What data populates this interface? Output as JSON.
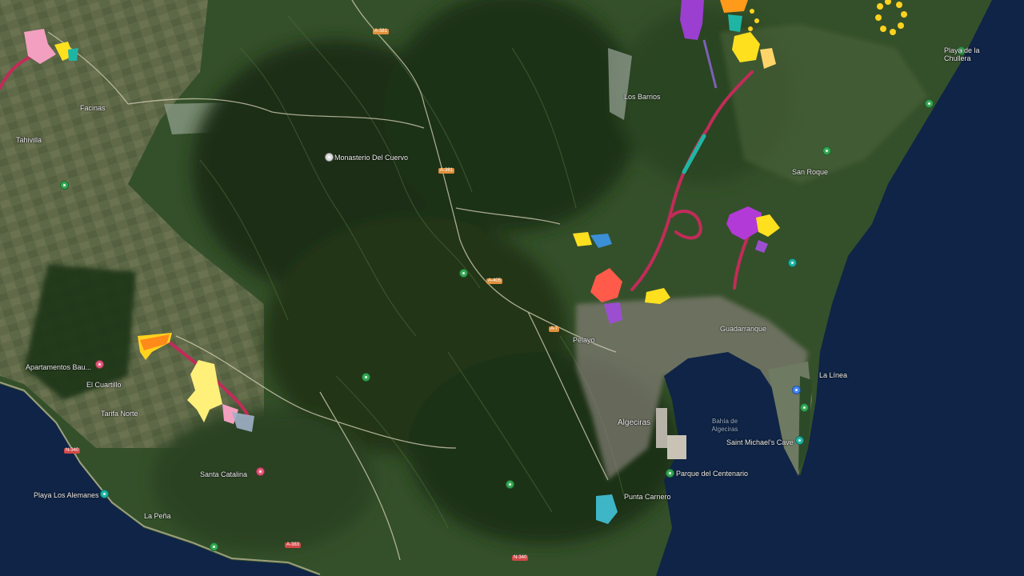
{
  "colors": {
    "sea": "#0f2447",
    "land_dark": "#223a1d",
    "land_mid": "#3d5a2e",
    "farmland": "#6b7051",
    "urban": "#8f8d86",
    "route": "#c22b59",
    "pin_green": "#34a853",
    "pin_pink": "#e8577b",
    "pin_blue": "#4285f4",
    "pin_teal": "#1fb5a4"
  },
  "labels": {
    "monastery": "Monasterio Del Cuervo",
    "bay": "Bahía de Algeciras",
    "algeciras": "Algeciras",
    "st_michaels": "Saint Michael's Cave",
    "parque": "Parque del Centenario",
    "playa_chullera": "Playa de la Chullera",
    "playa_alemanes": "Playa Los Alemanes",
    "apartamentos": "Apartamentos Bau...",
    "santa_catalina": "Santa Catalina",
    "punta_carnero": "Punta Carnero",
    "los_barrios": "Los Barrios",
    "la_linea": "La Línea",
    "guadarranque": "Guadarranque",
    "san_roque": "San Roque",
    "facinas": "Facinas",
    "tahivilla": "Tahivilla",
    "el_cuartillo": "El Cuartillo",
    "pelayo": "Pelayo",
    "tarifa_norte": "Tarifa Norte",
    "la_pena": "La Peña"
  },
  "roads": {
    "a381_north": "A-381",
    "a381_mid": "A-381",
    "a7": "A-7",
    "a405": "A-405",
    "n340_west": "N-340",
    "n340_south": "N-340",
    "n351": "A-383"
  }
}
